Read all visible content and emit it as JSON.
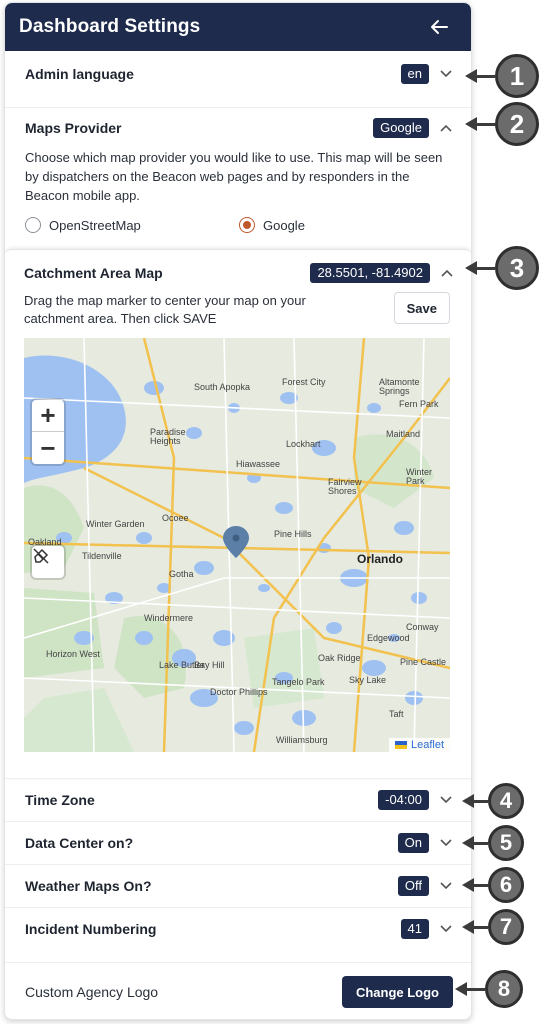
{
  "header": {
    "title": "Dashboard Settings"
  },
  "admin_language": {
    "label": "Admin language",
    "value": "en"
  },
  "maps_provider": {
    "label": "Maps Provider",
    "value": "Google",
    "description": "Choose which map provider you would like to use. This map will be seen by dispatchers on the Beacon web pages and by responders in the Beacon mobile app.",
    "options": [
      {
        "label": "OpenStreetMap",
        "selected": false
      },
      {
        "label": "Google",
        "selected": true
      }
    ]
  },
  "catchment": {
    "label": "Catchment Area Map",
    "value": "28.5501, -81.4902",
    "instructions": "Drag the map marker to center your map on your catchment area. Then click SAVE",
    "save_label": "Save",
    "zoom_in": "+",
    "zoom_out": "−",
    "attribution": "Leaflet",
    "map_labels": {
      "orlando": "Orlando",
      "apopka": "South Apopka",
      "forest_city": "Forest City",
      "altamonte": "Altamonte Springs",
      "winter_garden": "Winter Garden",
      "ocoee": "Ocoee",
      "pine_hills": "Pine Hills",
      "lockhart": "Lockhart",
      "fairview": "Fairview Shores",
      "winter_park": "Winter Park",
      "gotha": "Gotha",
      "windermere": "Windermere",
      "lake_butler": "Lake Butler",
      "bay_hill": "Bay Hill",
      "oak_ridge": "Oak Ridge",
      "edgewood": "Edgewood",
      "sky_lake": "Sky Lake",
      "doctor_phillips": "Doctor Phillips",
      "tangelo_park": "Tangelo Park",
      "horizon_west": "Horizon West",
      "williamsburg": "Williamsburg",
      "paradise_heights": "Paradise Heights",
      "oakland": "Oakland",
      "tildenville": "Tildenville",
      "hiawassee": "Hiawassee",
      "maitland": "Maitland",
      "fern_park": "Fern Park",
      "conway": "Conway",
      "taft": "Taft",
      "pine_castle": "Pine Castle"
    }
  },
  "time_zone": {
    "label": "Time Zone",
    "value": "-04:00"
  },
  "data_center": {
    "label": "Data Center on?",
    "value": "On"
  },
  "weather_maps": {
    "label": "Weather Maps On?",
    "value": "Off"
  },
  "incident_numbering": {
    "label": "Incident Numbering",
    "value": "41"
  },
  "logo": {
    "label": "Custom Agency Logo",
    "button": "Change Logo"
  },
  "callouts": [
    "1",
    "2",
    "3",
    "4",
    "5",
    "6",
    "7",
    "8"
  ],
  "colors": {
    "navy": "#1e2b4c",
    "radio_accent": "#c0572f",
    "callout": "#6b6b6b"
  }
}
